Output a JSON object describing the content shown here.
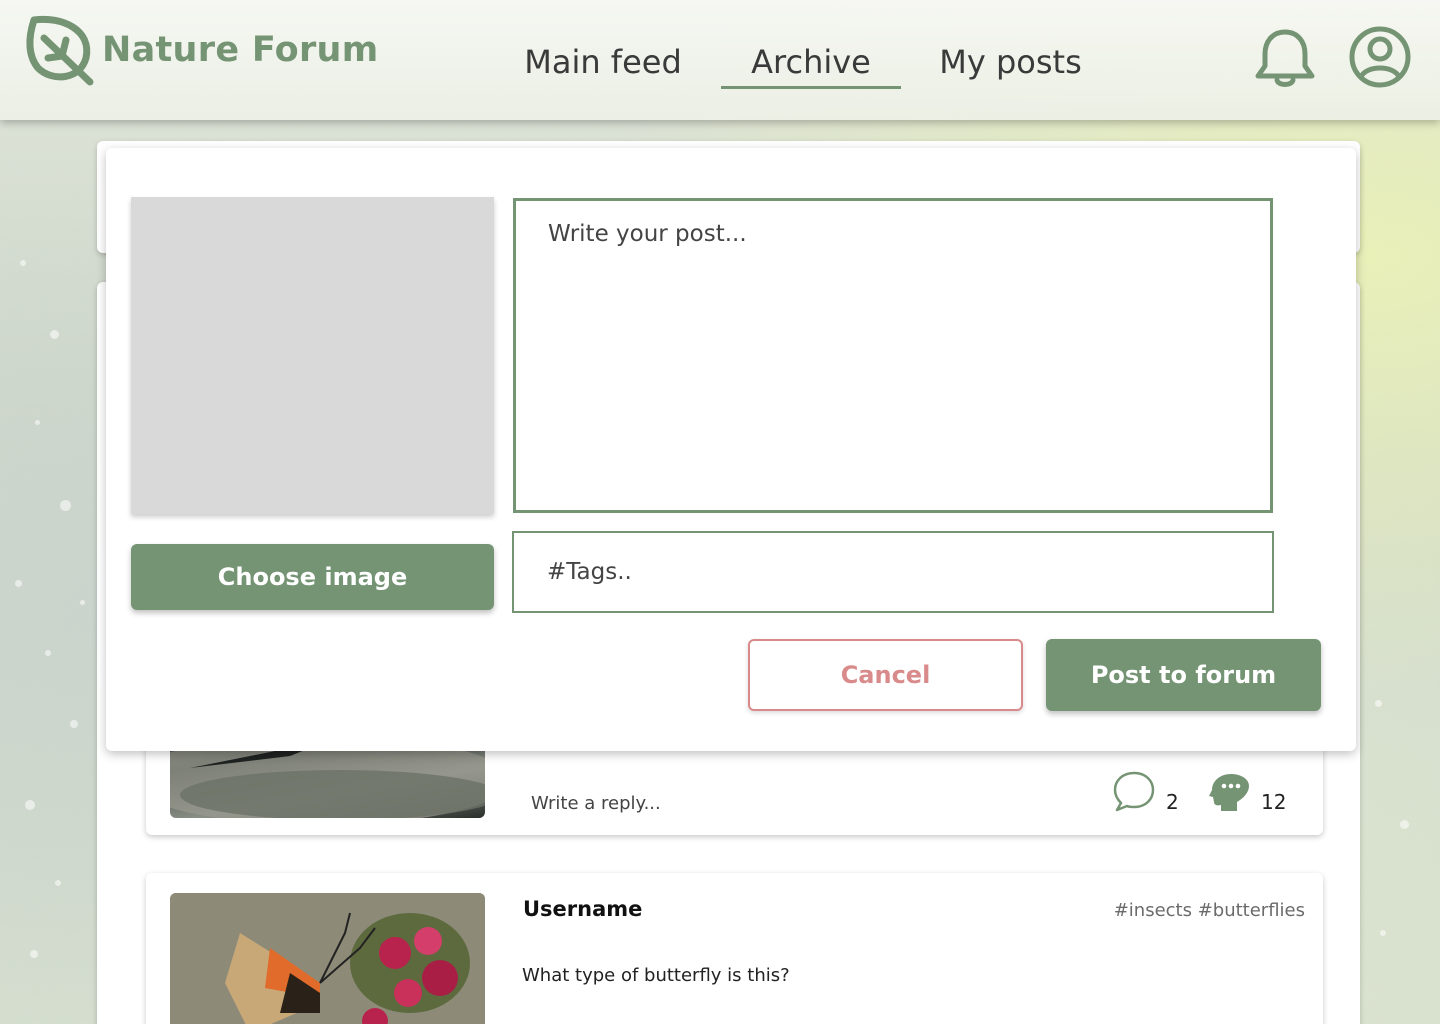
{
  "app": {
    "name": "Nature Forum",
    "accent_color": "#759474",
    "cancel_color": "#d98a8a"
  },
  "nav": {
    "items": [
      {
        "label": "Main feed",
        "active": false
      },
      {
        "label": "Archive",
        "active": true
      },
      {
        "label": "My posts",
        "active": false
      }
    ]
  },
  "header_icons": {
    "notifications": "bell-icon",
    "profile": "user-avatar-icon"
  },
  "new_post_modal": {
    "choose_image_label": "Choose image",
    "post_placeholder": "Write your post...",
    "tags_placeholder": "#Tags..",
    "cancel_label": "Cancel",
    "submit_label": "Post to forum"
  },
  "feed": {
    "posts": [
      {
        "username": "",
        "tags": "",
        "text": "",
        "reply_placeholder": "Write a reply...",
        "comments": "2",
        "likes": "12"
      },
      {
        "username": "Username",
        "tags": "#insects #butterflies",
        "text": "What type of butterfly is this?"
      }
    ]
  }
}
